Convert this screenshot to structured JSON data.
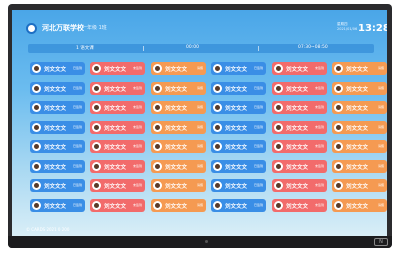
{
  "header": {
    "school_name": "河北万联学校",
    "class_name": "一年级 1班",
    "date_line1": "星期四",
    "date_line2": "2021/01/06",
    "clock": "13:28"
  },
  "schedule_bar": {
    "left": "1 语文课",
    "middle": "00:00",
    "right": "07:30~08:50"
  },
  "footer_text": "© CARDS 2021 0 200",
  "student_name": "刘文文文",
  "rows": [
    [
      {
        "name": "刘文文文",
        "tag": "已签到",
        "color": "blue"
      },
      {
        "name": "刘文文文",
        "tag": "未签到",
        "color": "red"
      },
      {
        "name": "刘文文文",
        "tag": "请假",
        "color": "orange"
      },
      {
        "name": "刘文文文",
        "tag": "已签到",
        "color": "blue"
      },
      {
        "name": "刘文文文",
        "tag": "未签到",
        "color": "red"
      },
      {
        "name": "刘文文文",
        "tag": "请假",
        "color": "orange"
      }
    ],
    [
      {
        "name": "刘文文文",
        "tag": "已签到",
        "color": "blue"
      },
      {
        "name": "刘文文文",
        "tag": "未签到",
        "color": "red"
      },
      {
        "name": "刘文文文",
        "tag": "请假",
        "color": "orange"
      },
      {
        "name": "刘文文文",
        "tag": "已签到",
        "color": "blue"
      },
      {
        "name": "刘文文文",
        "tag": "未签到",
        "color": "red"
      },
      {
        "name": "刘文文文",
        "tag": "请假",
        "color": "orange"
      }
    ],
    [
      {
        "name": "刘文文文",
        "tag": "已签到",
        "color": "blue"
      },
      {
        "name": "刘文文文",
        "tag": "未签到",
        "color": "red"
      },
      {
        "name": "刘文文文",
        "tag": "请假",
        "color": "orange"
      },
      {
        "name": "刘文文文",
        "tag": "已签到",
        "color": "blue"
      },
      {
        "name": "刘文文文",
        "tag": "未签到",
        "color": "red"
      },
      {
        "name": "刘文文文",
        "tag": "请假",
        "color": "orange"
      }
    ],
    [
      {
        "name": "刘文文文",
        "tag": "已签到",
        "color": "blue"
      },
      {
        "name": "刘文文文",
        "tag": "未签到",
        "color": "red"
      },
      {
        "name": "刘文文文",
        "tag": "请假",
        "color": "orange"
      },
      {
        "name": "刘文文文",
        "tag": "已签到",
        "color": "blue"
      },
      {
        "name": "刘文文文",
        "tag": "未签到",
        "color": "red"
      },
      {
        "name": "刘文文文",
        "tag": "请假",
        "color": "orange"
      }
    ],
    [
      {
        "name": "刘文文文",
        "tag": "已签到",
        "color": "blue"
      },
      {
        "name": "刘文文文",
        "tag": "未签到",
        "color": "red"
      },
      {
        "name": "刘文文文",
        "tag": "请假",
        "color": "orange"
      },
      {
        "name": "刘文文文",
        "tag": "已签到",
        "color": "blue"
      },
      {
        "name": "刘文文文",
        "tag": "未签到",
        "color": "red"
      },
      {
        "name": "刘文文文",
        "tag": "请假",
        "color": "orange"
      }
    ],
    [
      {
        "name": "刘文文文",
        "tag": "已签到",
        "color": "blue"
      },
      {
        "name": "刘文文文",
        "tag": "未签到",
        "color": "red"
      },
      {
        "name": "刘文文文",
        "tag": "请假",
        "color": "orange"
      },
      {
        "name": "刘文文文",
        "tag": "已签到",
        "color": "blue"
      },
      {
        "name": "刘文文文",
        "tag": "未签到",
        "color": "red"
      },
      {
        "name": "刘文文文",
        "tag": "请假",
        "color": "orange"
      }
    ],
    [
      {
        "name": "刘文文文",
        "tag": "已签到",
        "color": "blue"
      },
      {
        "name": "刘文文文",
        "tag": "未签到",
        "color": "red"
      },
      {
        "name": "刘文文文",
        "tag": "请假",
        "color": "orange"
      },
      {
        "name": "刘文文文",
        "tag": "已签到",
        "color": "blue"
      },
      {
        "name": "刘文文文",
        "tag": "未签到",
        "color": "red"
      },
      {
        "name": "刘文文文",
        "tag": "请假",
        "color": "orange"
      }
    ],
    [
      {
        "name": "刘文文文",
        "tag": "已签到",
        "color": "blue"
      },
      {
        "name": "刘文文文",
        "tag": "未签到",
        "color": "red"
      },
      {
        "name": "刘文文文",
        "tag": "请假",
        "color": "orange"
      },
      {
        "name": "刘文文文",
        "tag": "已签到",
        "color": "blue"
      },
      {
        "name": "刘文文文",
        "tag": "未签到",
        "color": "red"
      },
      {
        "name": "刘文文文",
        "tag": "请假",
        "color": "orange"
      }
    ]
  ],
  "colors": {
    "blue": "#3a8ee6",
    "red": "#f26b6b",
    "orange": "#f59a52"
  }
}
